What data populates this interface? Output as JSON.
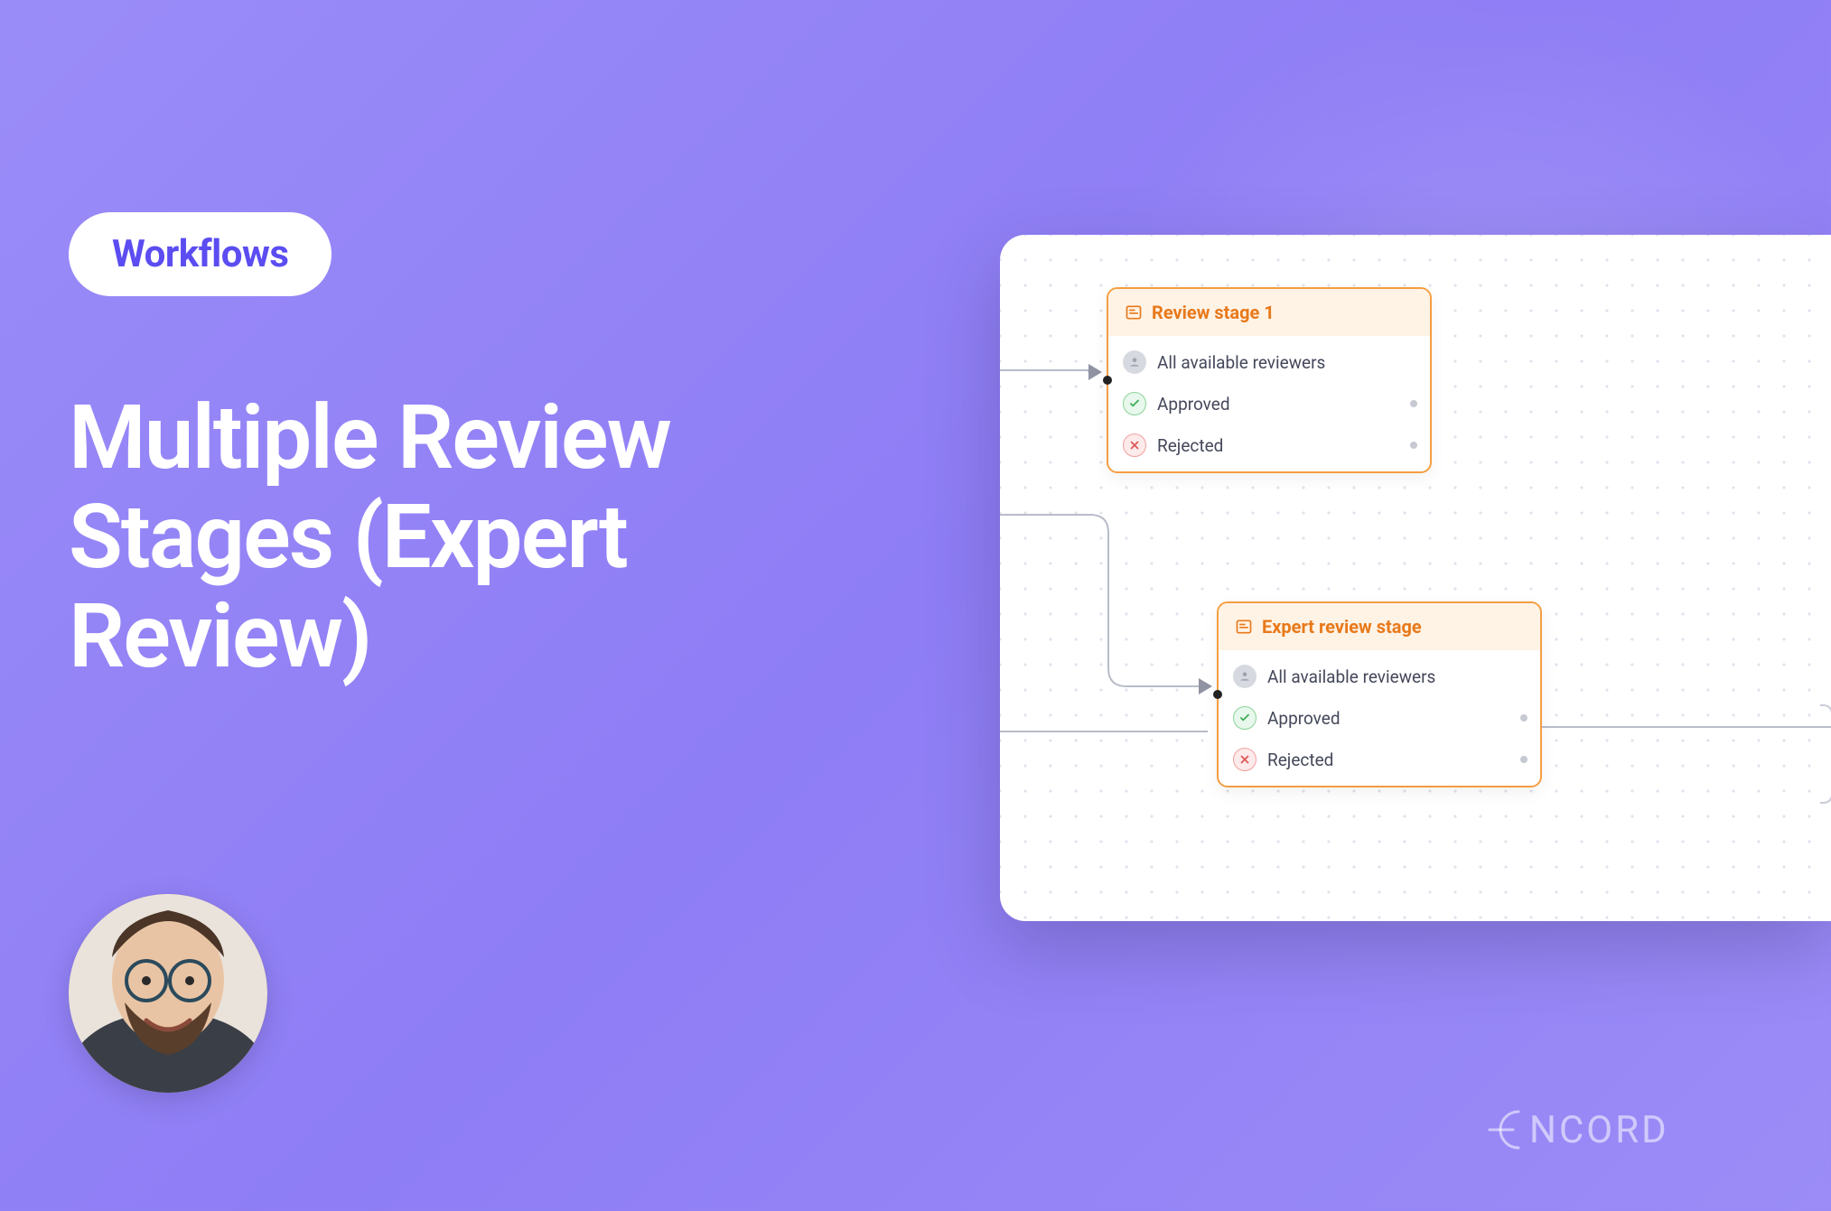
{
  "chip": {
    "label": "Workflows"
  },
  "title": "Multiple Review Stages (Expert Review)",
  "brand": "ENCORD",
  "nodes": [
    {
      "title": "Review stage 1",
      "reviewers": "All available reviewers",
      "approved": "Approved",
      "rejected": "Rejected"
    },
    {
      "title": "Expert review stage",
      "reviewers": "All available reviewers",
      "approved": "Approved",
      "rejected": "Rejected"
    }
  ]
}
